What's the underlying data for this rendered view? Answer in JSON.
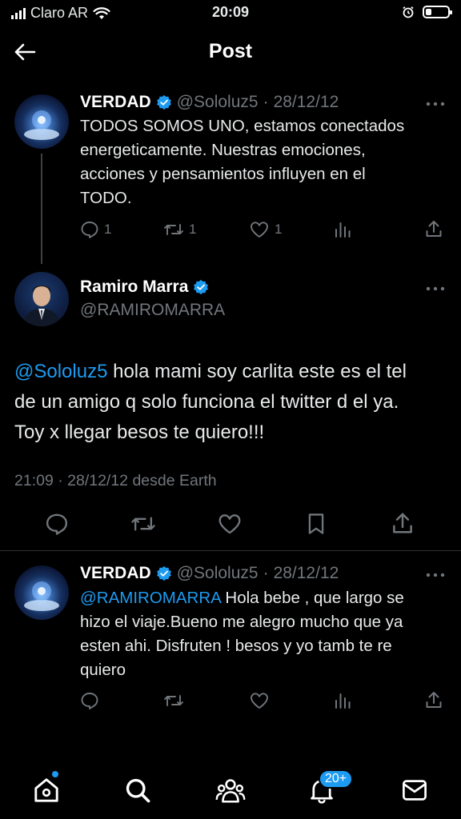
{
  "status_bar": {
    "carrier": "Claro AR",
    "time": "20:09"
  },
  "header": {
    "title": "Post"
  },
  "tweets": [
    {
      "display_name": "VERDAD",
      "handle": "@Sololuz5",
      "date": "28/12/12",
      "text_lines": [
        "TODOS SOMOS UNO, estamos conectados",
        "energeticamente. Nuestras emociones,",
        "acciones y pensamientos influyen en el",
        "TODO."
      ],
      "replies": "1",
      "reposts": "1",
      "likes": "1"
    },
    {
      "display_name": "VERDAD",
      "handle": "@Sololuz5",
      "date": "28/12/12",
      "mention": "@RAMIROMARRA",
      "text_first": " Hola bebe , que largo se",
      "text_lines": [
        "hizo el viaje.Bueno me alegro mucho que ya",
        "esten ahi. Disfruten ! besos y yo tamb te re",
        "quiero"
      ]
    }
  ],
  "main_post": {
    "display_name": "Ramiro Marra",
    "handle": "@RAMIROMARRA",
    "mention": "@Sololuz5",
    "text_first": " hola mami soy carlita este es el tel",
    "text_lines": [
      "de un amigo q solo funciona el twitter d el ya.",
      "Toy x llegar besos te quiero!!!"
    ],
    "meta": "21:09 · 28/12/12 desde Earth"
  },
  "bottom_nav": {
    "notification_badge": "20+"
  },
  "colors": {
    "accent": "#1d9bf0",
    "muted": "#71767b",
    "background": "#000000",
    "text": "#e7e9ea"
  },
  "icons": [
    "signal-icon",
    "wifi-icon",
    "alarm-icon",
    "battery-icon",
    "back-arrow-icon",
    "verified-badge-icon",
    "more-icon",
    "reply-icon",
    "repost-icon",
    "like-icon",
    "views-icon",
    "share-icon",
    "bookmark-icon",
    "home-icon",
    "search-icon",
    "communities-icon",
    "notifications-icon",
    "messages-icon"
  ]
}
